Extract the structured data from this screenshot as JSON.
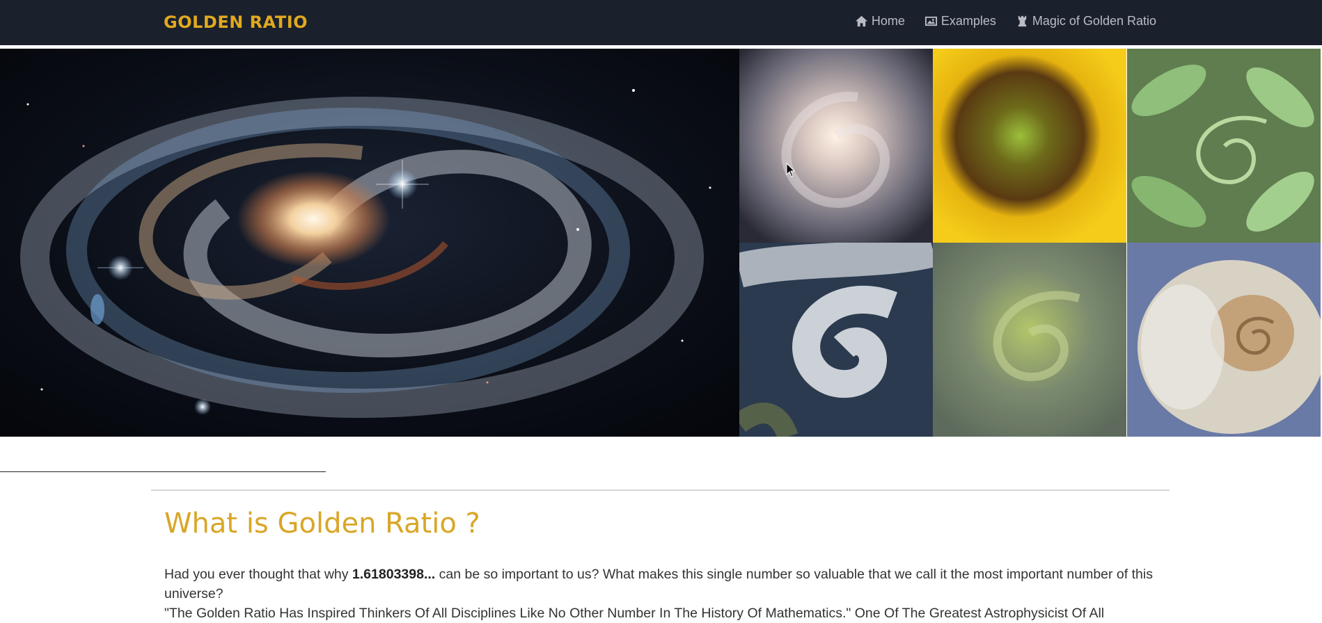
{
  "navbar": {
    "brand": "GOLDEN RATIO",
    "links": [
      {
        "label": "Home",
        "icon": "home-icon"
      },
      {
        "label": "Examples",
        "icon": "picture-icon"
      },
      {
        "label": "Magic of Golden Ratio",
        "icon": "chess-rook-icon"
      }
    ]
  },
  "hero": {
    "main_image": "spiral-galaxy-image",
    "tiles": [
      "spiral-galaxy",
      "sunflower",
      "fern-spiral",
      "cyclone",
      "spiral-aloe",
      "nautilus-shell"
    ]
  },
  "content": {
    "heading": "What is Golden Ratio ?",
    "para_pre": "Had you ever thought that why ",
    "para_bold": "1.61803398...",
    "para_post": " can be so important to us? What makes this single number so valuable that we call it the most important number of this universe?",
    "quote": "\"The Golden Ratio Has Inspired Thinkers Of All Disciplines Like No Other Number In The History Of Mathematics.\" One Of The Greatest Astrophysicist Of All"
  },
  "colors": {
    "navbar_bg": "#1b202d",
    "brand": "#e0a91e",
    "heading": "#d9a627",
    "nav_link": "#b9bcc4"
  }
}
